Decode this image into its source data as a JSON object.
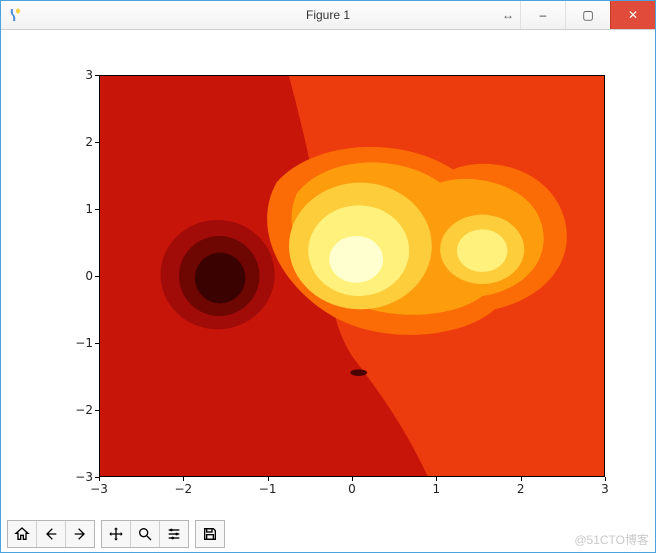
{
  "window": {
    "title": "Figure 1",
    "controls": {
      "resize": "↔",
      "minimize": "–",
      "maximize": "▢",
      "close": "✕"
    }
  },
  "chart_data": {
    "type": "heatmap",
    "title": "",
    "xlabel": "",
    "ylabel": "",
    "xlim": [
      -3,
      3
    ],
    "ylim": [
      -3,
      3
    ],
    "xticks": [
      -3,
      -2,
      -1,
      0,
      1,
      2,
      3
    ],
    "yticks": [
      -3,
      -2,
      -1,
      0,
      1,
      2,
      3
    ],
    "description": "Filled contour plot using a red-yellow 'hot' colormap. Three Gaussian-like features: a negative (dark/black) lobe centered near (-1.8, -0.1); a large positive (bright yellow-white) lobe centered near (-0.1, 0.1); a secondary positive (yellow) lobe centered near (1.4, 0.2). Background transitions from darker red at lower-left to orange-red at upper-right, with a small dark speck near (0, -1.5).",
    "features": [
      {
        "name": "negative-lobe",
        "center": [
          -1.8,
          -0.1
        ],
        "approx_radius": 0.8,
        "sign": "low"
      },
      {
        "name": "primary-positive",
        "center": [
          -0.1,
          0.1
        ],
        "approx_radius": 1.2,
        "sign": "high"
      },
      {
        "name": "secondary-positive",
        "center": [
          1.4,
          0.2
        ],
        "approx_radius": 0.7,
        "sign": "high"
      },
      {
        "name": "small-dark-spot",
        "center": [
          0.0,
          -1.5
        ],
        "approx_radius": 0.1,
        "sign": "low"
      }
    ],
    "colormap": "hot",
    "contour_levels_approx": 10
  },
  "toolbar": {
    "buttons": [
      "home",
      "back",
      "forward",
      "pan",
      "zoom",
      "configure",
      "save"
    ]
  },
  "watermark": "@51CTO博客"
}
